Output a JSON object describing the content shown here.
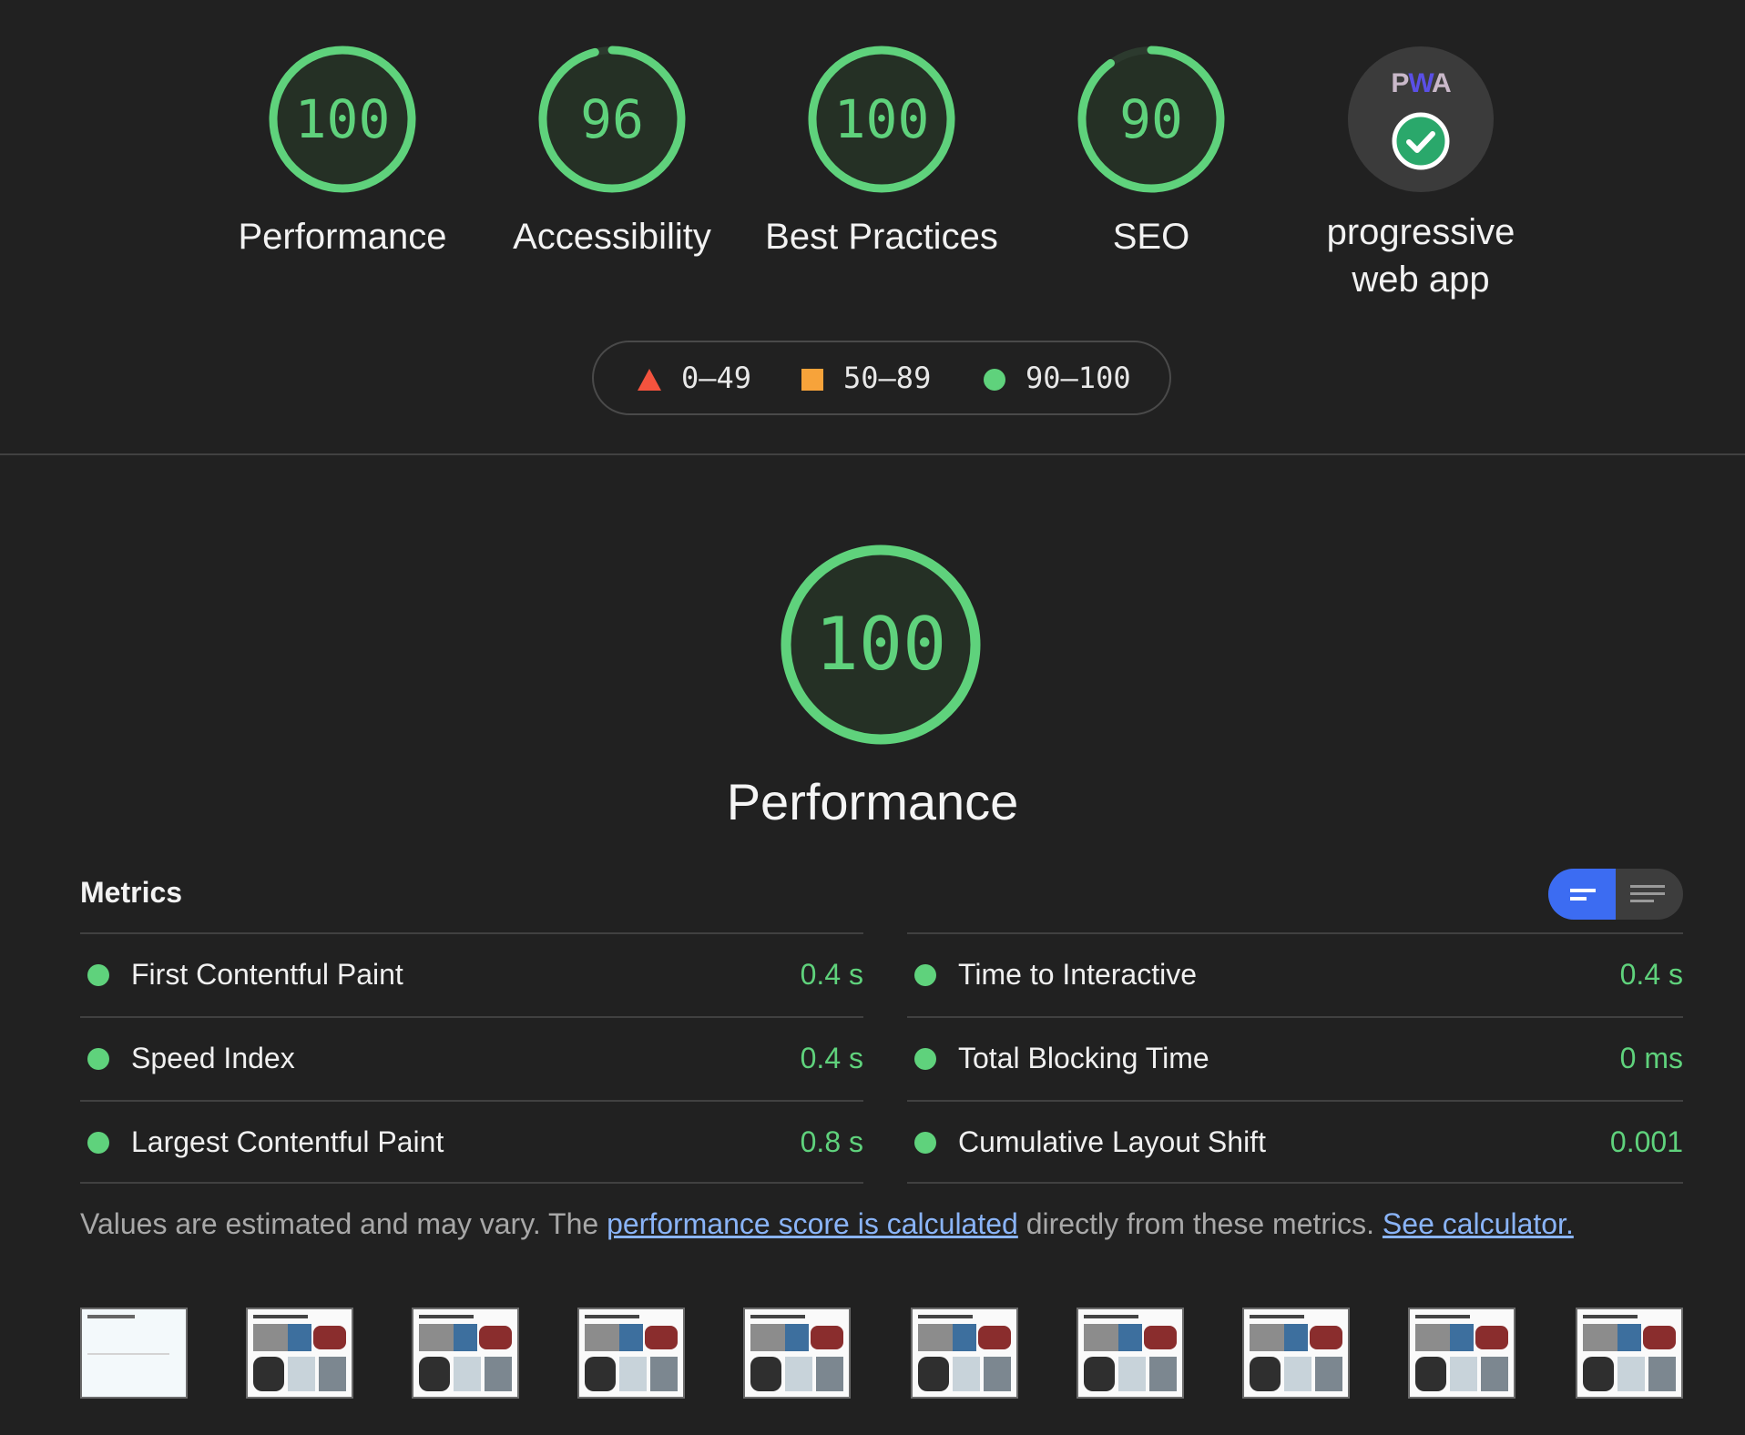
{
  "scores": [
    {
      "value": "100",
      "label": "Performance",
      "fraction": 1.0
    },
    {
      "value": "96",
      "label": "Accessibility",
      "fraction": 0.96
    },
    {
      "value": "100",
      "label": "Best Practices",
      "fraction": 1.0
    },
    {
      "value": "90",
      "label": "SEO",
      "fraction": 0.9
    }
  ],
  "pwa": {
    "logo": "PWA",
    "label_line1": "progressive",
    "label_line2": "web app"
  },
  "legend": {
    "fail": "0–49",
    "average": "50–89",
    "pass": "90–100"
  },
  "colors": {
    "pass": "#5fd27c",
    "average": "#f7a33a",
    "fail": "#f4533e",
    "accent": "#3c6cf2",
    "link": "#8ab4f8"
  },
  "performance": {
    "score": "100",
    "title": "Performance",
    "fraction": 1.0
  },
  "metrics": {
    "title": "Metrics",
    "left": [
      {
        "name": "First Contentful Paint",
        "value": "0.4 s"
      },
      {
        "name": "Speed Index",
        "value": "0.4 s"
      },
      {
        "name": "Largest Contentful Paint",
        "value": "0.8 s"
      }
    ],
    "right": [
      {
        "name": "Time to Interactive",
        "value": "0.4 s"
      },
      {
        "name": "Total Blocking Time",
        "value": "0 ms"
      },
      {
        "name": "Cumulative Layout Shift",
        "value": "0.001"
      }
    ]
  },
  "note": {
    "prefix": "Values are estimated and may vary. The ",
    "link1": "performance score is calculated",
    "middle": " directly from these metrics. ",
    "link2": "See calculator."
  },
  "icons": {
    "toggle_active": "compact-view-icon",
    "toggle_inactive": "expanded-view-icon",
    "pwa_check": "check-circle-icon"
  }
}
